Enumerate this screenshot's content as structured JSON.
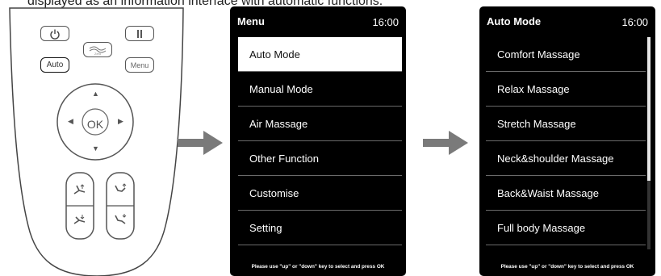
{
  "caption": "displayed as an information interface with automatic functions.",
  "remote": {
    "auto_label": "Auto",
    "menu_label": "Menu",
    "ok_label": "OK",
    "zero_label": "Zero"
  },
  "menu_screen": {
    "title": "Menu",
    "time": "16:00",
    "items": [
      {
        "label": "Auto Mode"
      },
      {
        "label": "Manual Mode"
      },
      {
        "label": "Air Massage"
      },
      {
        "label": "Other Function"
      },
      {
        "label": "Customise"
      },
      {
        "label": "Setting"
      }
    ],
    "selected_index": 0,
    "footer": "Please use \"up\" or \"down\" key to select and press OK"
  },
  "auto_screen": {
    "title": "Auto Mode",
    "time": "16:00",
    "items": [
      {
        "label": "Comfort Massage"
      },
      {
        "label": "Relax Massage"
      },
      {
        "label": "Stretch Massage"
      },
      {
        "label": "Neck&shoulder Massage"
      },
      {
        "label": "Back&Waist Massage"
      },
      {
        "label": "Full body Massage"
      }
    ],
    "footer": "Please use \"up\" or \"down\" key to select and press OK"
  },
  "colors": {
    "screen_bg": "#000000",
    "selected_bg": "#ffffff",
    "divider": "#6a6a6a",
    "arrow": "#7a7a7a"
  },
  "icons": [
    "power-icon",
    "pause-icon",
    "zero-gravity-icon",
    "up-arrow-icon",
    "down-arrow-icon",
    "left-arrow-icon",
    "right-arrow-icon",
    "recline-up-icon",
    "recline-down-icon",
    "legrest-up-icon",
    "legrest-down-icon",
    "flow-arrow-icon"
  ]
}
